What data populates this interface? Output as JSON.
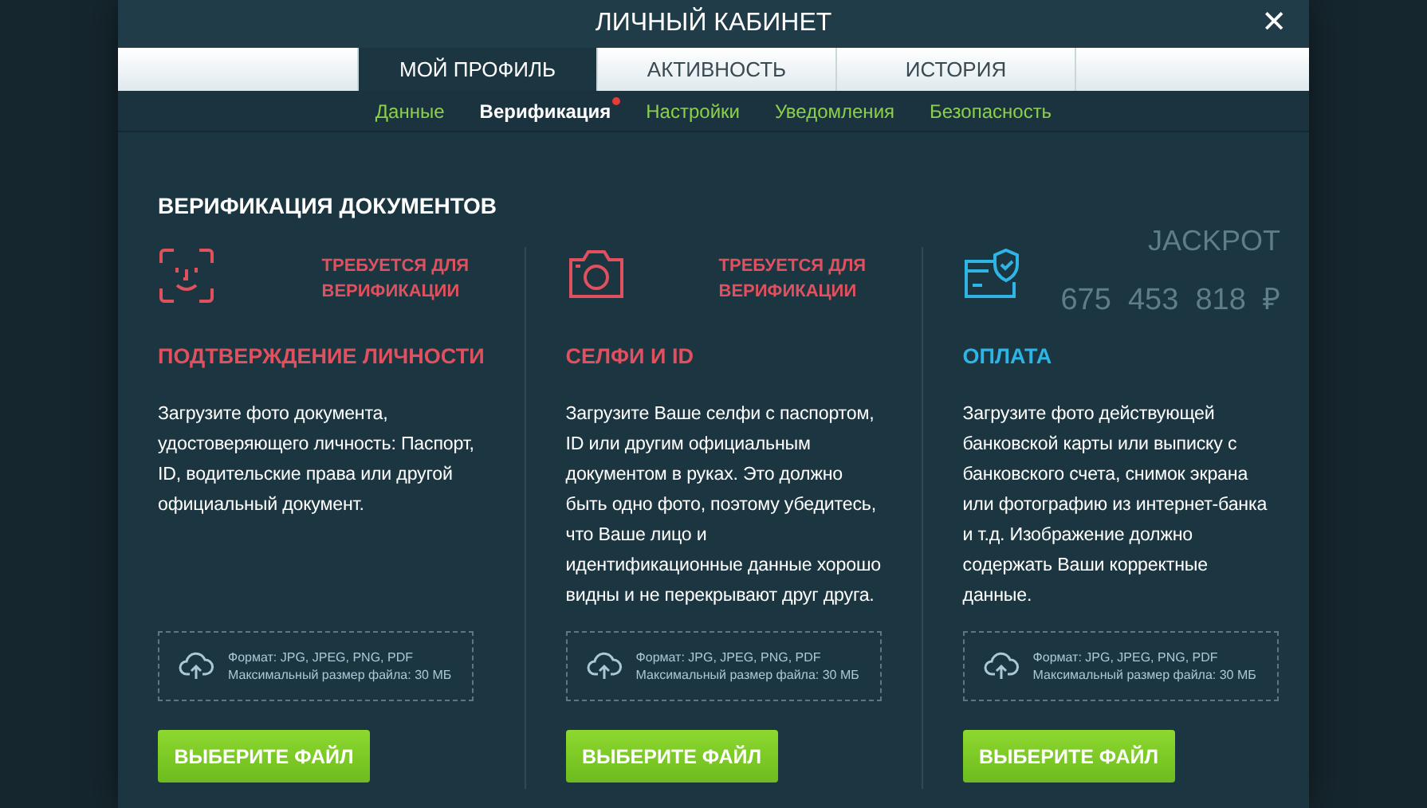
{
  "window": {
    "title": "ЛИЧНЫЙ КАБИНЕТ",
    "close": "✕"
  },
  "tabs": [
    {
      "label": "МОЙ ПРОФИЛЬ",
      "selected": true
    },
    {
      "label": "АКТИВНОСТЬ",
      "selected": false
    },
    {
      "label": "ИСТОРИЯ",
      "selected": false
    }
  ],
  "subnav": [
    {
      "label": "Данные",
      "selected": false,
      "alert": false
    },
    {
      "label": "Верификация",
      "selected": true,
      "alert": true
    },
    {
      "label": "Настройки",
      "selected": false,
      "alert": false
    },
    {
      "label": "Уведомления",
      "selected": false,
      "alert": false
    },
    {
      "label": "Безопасность",
      "selected": false,
      "alert": false
    }
  ],
  "background": {
    "jackpot_label": "JACKPOT",
    "jackpot_amount": "675  453  818  ₽"
  },
  "heading": "ВЕРИФИКАЦИЯ ДОКУМЕНТОВ",
  "cards": [
    {
      "kind": "face",
      "status": "ТРЕБУЕТСЯ ДЛЯ\nВЕРИФИКАЦИИ",
      "title": "ПОДТВЕРЖДЕНИЕ ЛИЧНОСТИ",
      "color": "#e0505e",
      "description": "Загрузите фото документа, удостоверяющего личность: Паспорт, ID, водительские права или другой официальный документ.",
      "format": "Формат: JPG, JPEG, PNG, PDF",
      "max_size": "Максимальный размер файла: 30 МБ",
      "button": "ВЫБЕРИТЕ ФАЙЛ"
    },
    {
      "kind": "camera",
      "status": "ТРЕБУЕТСЯ ДЛЯ\nВЕРИФИКАЦИИ",
      "title": "СЕЛФИ И ID",
      "color": "#e0505e",
      "description": "Загрузите Ваше селфи с паспортом, ID или другим официальным документом в руках. Это должно быть одно фото, поэтому убедитесь, что Ваше лицо и идентификационные данные хорошо видны и не перекрывают друг друга.",
      "format": "Формат: JPG, JPEG, PNG, PDF",
      "max_size": "Максимальный размер файла: 30 МБ",
      "button": "ВЫБЕРИТЕ ФАЙЛ"
    },
    {
      "kind": "card",
      "title": "ОПЛАТА",
      "color": "#2fb4e6",
      "description": "Загрузите фото действующей банковской карты или выписку с банковского счета, снимок экрана или фотографию из интернет-банка и т.д. Изображение должно содержать Ваши корректные данные.",
      "format": "Формат: JPG, JPEG, PNG, PDF",
      "max_size": "Максимальный размер файла: 30 МБ",
      "button": "ВЫБЕРИТЕ ФАЙЛ"
    }
  ]
}
